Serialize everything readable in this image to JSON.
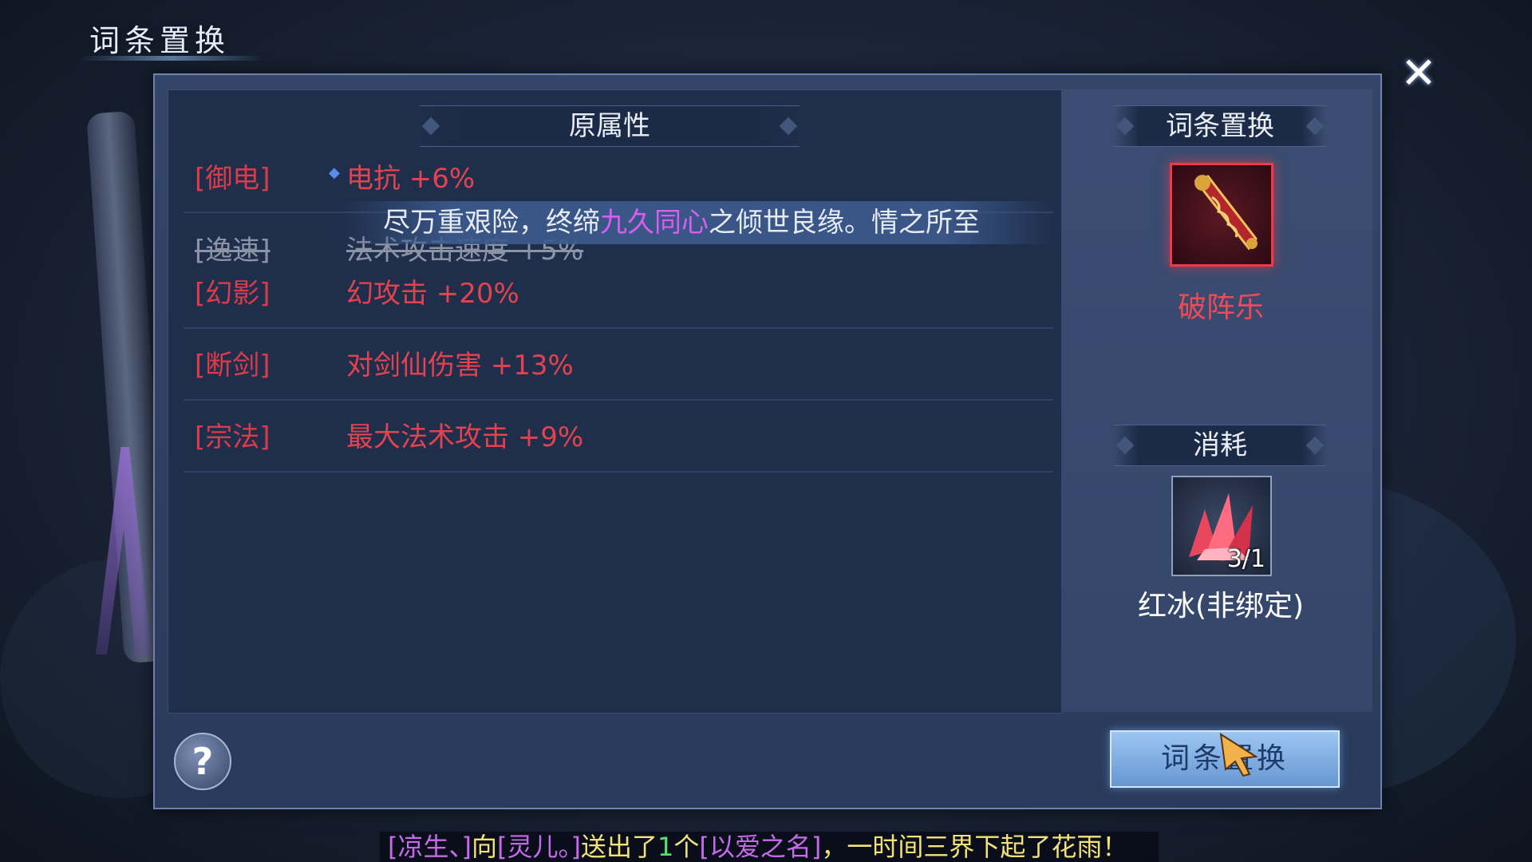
{
  "window": {
    "title": "词条置换"
  },
  "left": {
    "header": "原属性",
    "rows": [
      {
        "tag": "[御电]",
        "value": "电抗 +6%",
        "struck": false
      },
      {
        "tag": "[逸速]",
        "value": "法术攻击速度 +5%",
        "struck": true
      },
      {
        "tag": "[幻影]",
        "value": "幻攻击 +20%",
        "struck": false
      },
      {
        "tag": "[断剑]",
        "value": "对剑仙伤害 +13%",
        "struck": false
      },
      {
        "tag": "[宗法]",
        "value": "最大法术攻击 +9%",
        "struck": false
      }
    ]
  },
  "marquee": {
    "before": "尽万重艰险，终缔",
    "highlight": "九久同心",
    "after": "之倾世良缘。情之所至"
  },
  "right": {
    "replace_header": "词条置换",
    "item_name": "破阵乐",
    "cost_header": "消耗",
    "cost_count": "3/1",
    "cost_name": "红冰(非绑定)"
  },
  "buttons": {
    "help": "?",
    "action": "词条置换",
    "close": "✕"
  },
  "broadcast": {
    "p1": "[凉生、]",
    "t1": "向",
    "p2": "[灵儿。]",
    "t2": "送出了",
    "count": "1",
    "t3": "个",
    "p3": "[以爱之名]",
    "t4": "，一时间三界下起了花雨！"
  },
  "colors": {
    "attr_red": "#e2434f",
    "highlight_purple": "#d45ff0",
    "accent_blue": "#6796d2"
  }
}
